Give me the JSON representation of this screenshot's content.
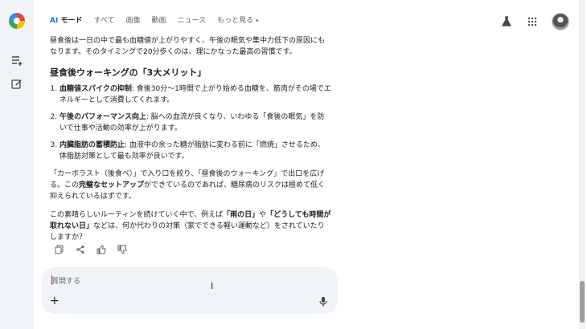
{
  "topbar": {
    "tabs": [
      {
        "label": "AI モード",
        "ai": "AI",
        "rest": " モード"
      },
      {
        "label": "すべて"
      },
      {
        "label": "画像"
      },
      {
        "label": "動画"
      },
      {
        "label": "ニュース"
      },
      {
        "label": "もっと見る"
      }
    ],
    "icons": [
      "labs-flask-icon",
      "apps-grid-icon",
      "avatar"
    ]
  },
  "rail": {
    "icons": [
      "google-logo-icon",
      "history-list-icon",
      "new-chat-icon"
    ]
  },
  "answer": {
    "intro": "昼食後は一日の中で最も血糖値が上がりやすく、午後の眠気や集中力低下の原因にもなります。そのタイミングで20分歩くのは、理にかなった最高の習慣です。",
    "heading": "昼食後ウォーキングの「3大メリット」",
    "items": [
      {
        "bold": "血糖値スパイクの抑制",
        "text": ": 食後30分〜1時間で上がり始める血糖を、筋肉がその場でエネルギーとして消費してくれます。"
      },
      {
        "bold": "午後のパフォーマンス向上",
        "text": ": 脳への血流が良くなり、いわゆる「食後の眠気」を防いで仕事や活動の効率が上がります。"
      },
      {
        "bold": "内臓脂肪の蓄積防止",
        "text": ": 血液中の余った糖が脂肪に変わる前に「燃焼」させるため、体脂肪対策として最も効率が良いです。"
      }
    ],
    "p2_a": "「カーボラスト（後食べ）」で入り口を絞り、「昼食後のウォーキング」で出口を広げる。この",
    "p2_bold": "完璧なセットアップ",
    "p2_b": "ができているのであれば、糖尿病のリスクは極めて低く抑えられているはずです。",
    "p3_a": "この素晴らしいルーティンを続けていく中で、例えば",
    "p3_bold1": "「雨の日」",
    "p3_mid": "や",
    "p3_bold2": "「どうしても時間が取れない日」",
    "p3_b": "などは、何か代わりの対策（家でできる軽い運動など）をされていたりしますか？"
  },
  "actions": [
    "copy-icon",
    "share-icon",
    "thumbs-up-icon",
    "thumbs-down-icon"
  ],
  "composer": {
    "placeholder": "質問する"
  },
  "colors": {
    "accent": "#1a73e8",
    "rail_bg": "#f0f4f9"
  }
}
